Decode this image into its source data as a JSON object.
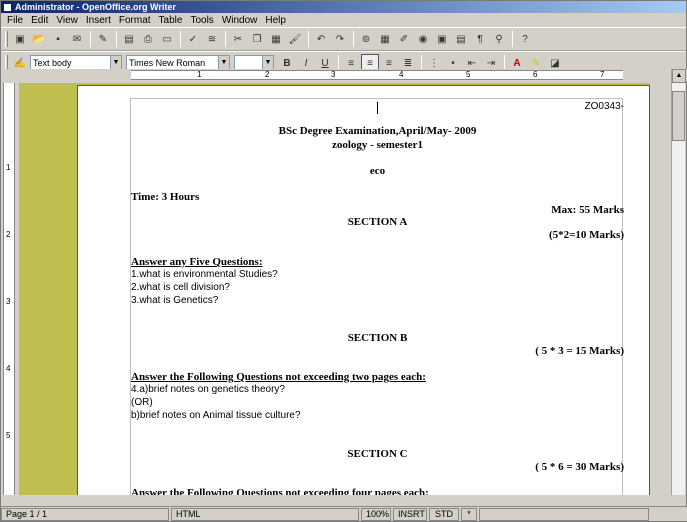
{
  "window": {
    "title": "Administrator - OpenOffice.org Writer"
  },
  "menu": [
    "File",
    "Edit",
    "View",
    "Insert",
    "Format",
    "Table",
    "Tools",
    "Window",
    "Help"
  ],
  "format_bar": {
    "style": "Text body",
    "font": "Times New Roman",
    "size": ""
  },
  "ruler": {
    "numbers": [
      "1",
      "2",
      "3",
      "4",
      "5",
      "6",
      "7"
    ]
  },
  "vruler": {
    "numbers": [
      "1",
      "2",
      "3",
      "4",
      "5"
    ]
  },
  "document": {
    "code": "ZO0343-",
    "exam": "BSc Degree Examination,April/May- 2009",
    "subject": "zoology - semester1",
    "paper": "eco",
    "time": "Time: 3 Hours",
    "max": "Max: 55 Marks",
    "section_a": "SECTION A",
    "marks_a": "(5*2=10 Marks)",
    "instr_a": "Answer any Five Questions:",
    "q1": "1.what is environmental Studies?",
    "q2": "2.what is cell division?",
    "q3": "3.what is Genetics?",
    "section_b": "SECTION B",
    "marks_b": "( 5 * 3 = 15 Marks)",
    "instr_b": "Answer the Following Questions not exceeding two pages each:",
    "q4a": "4.a)brief notes on genetics theory?",
    "or": "(OR)",
    "q4b": "b)brief notes on Animal tissue culture?",
    "section_c": "SECTION C",
    "marks_c": "( 5 * 6 = 30 Marks)",
    "instr_c": "Answer the Following Questions not exceeding four pages each:"
  },
  "status": {
    "page": "Page 1 / 1",
    "mode": "HTML",
    "zoom": "100%",
    "insert": "INSRT",
    "std": "STD",
    "star": "*"
  }
}
